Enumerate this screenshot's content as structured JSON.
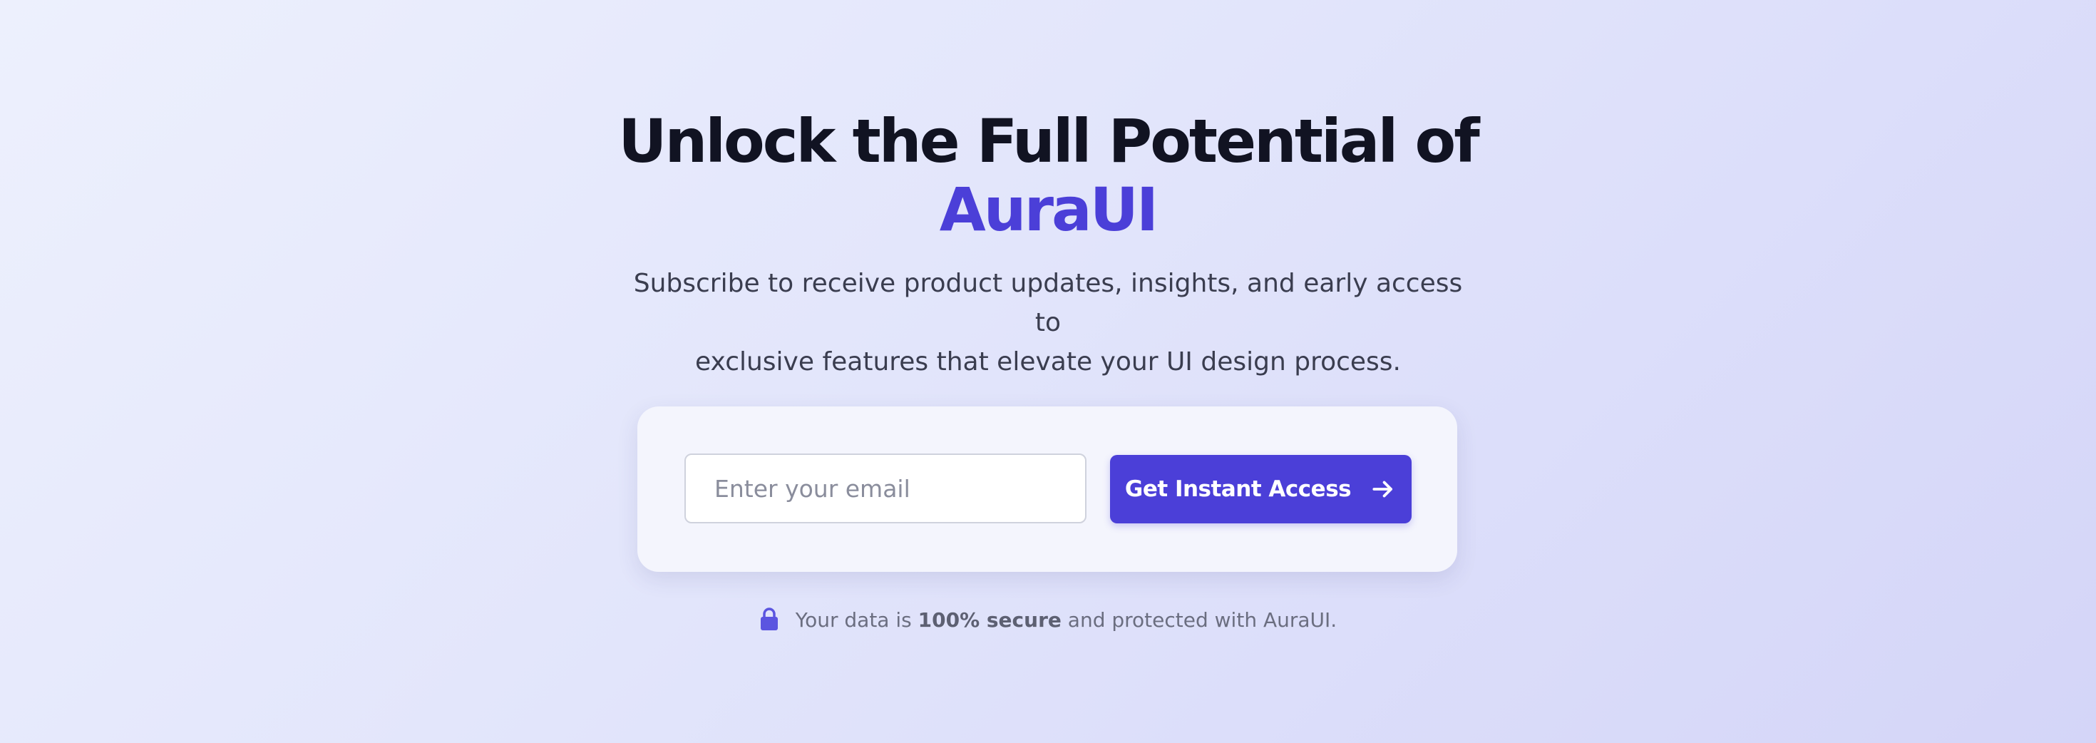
{
  "hero": {
    "headline_line1": "Unlock the Full Potential of",
    "headline_brand": "AuraUI",
    "subtitle_line1": "Subscribe to receive product updates, insights, and early access to",
    "subtitle_line2": "exclusive features that elevate your UI design process."
  },
  "form": {
    "email_placeholder": "Enter your email",
    "email_value": "",
    "submit_label": "Get Instant Access",
    "submit_icon": "arrow-right-icon"
  },
  "security_note": {
    "icon": "lock-icon",
    "prefix": "Your data is",
    "emphasis": "100% secure",
    "suffix": "and protected with AuraUI."
  },
  "colors": {
    "accent": "#4b3fd8",
    "headline": "#111322",
    "background_start": "#edf0fd",
    "background_end": "#d4d5f8"
  }
}
